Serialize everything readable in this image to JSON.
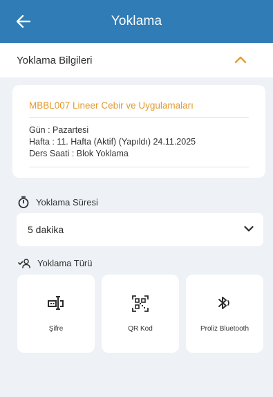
{
  "header": {
    "title": "Yoklama",
    "back_icon": "arrow-left-icon"
  },
  "section": {
    "title": "Yoklama Bilgileri",
    "toggle_icon": "chevron-up-icon",
    "accent": "#e39a2d"
  },
  "info": {
    "course": "MBBL007 Lineer Cebir ve Uygulamaları",
    "day": "Gün : Pazartesi",
    "week": "Hafta : 11. Hafta (Aktif) (Yapıldı) 24.11.2025",
    "hour": "Ders Saati : Blok Yoklama"
  },
  "duration": {
    "label": "Yoklama Süresi",
    "icon": "stopwatch-icon",
    "selected": "5 dakika"
  },
  "type": {
    "label": "Yoklama Türü",
    "icon": "users-check-icon",
    "options": [
      {
        "label": "Şifre",
        "icon": "password-icon"
      },
      {
        "label": "QR Kod",
        "icon": "qr-code-icon"
      },
      {
        "label": "Proliz Bluetooth",
        "icon": "bluetooth-icon"
      }
    ]
  },
  "colors": {
    "primary": "#2f7cb6",
    "accent": "#e39a2d",
    "background": "#eef2f6"
  }
}
